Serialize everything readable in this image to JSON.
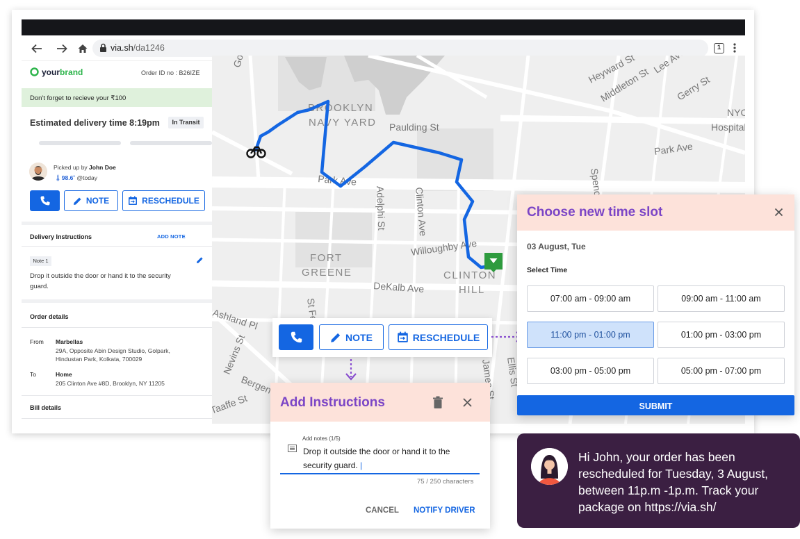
{
  "browser": {
    "url_domain": "via.sh",
    "url_path": "/da1246",
    "tab_count": "1",
    "icons": [
      "back-arrow-icon",
      "forward-arrow-icon",
      "home-icon",
      "lock-icon",
      "tabs-icon",
      "kebab-menu-icon"
    ]
  },
  "map": {
    "labels": [
      "Gold St",
      "BROOKLYN",
      "NAVY YARD",
      "Paulding St",
      "Park Ave",
      "Adelphi St",
      "Clinton Ave",
      "Willoughby Ave",
      "FORT",
      "GREENE",
      "DeKalb Ave",
      "CLINTON",
      "HILL",
      "Heyward St",
      "Middleton St",
      "Lee Ave",
      "Gerry St",
      "NYC",
      "Hospital",
      "Park Ave",
      "Spencer St",
      "St Felix",
      "Nevins St",
      "Bergen St",
      "Ashland Pl",
      "James St",
      "Ellis St",
      "Taaffe St"
    ],
    "route_color": "#1466e2",
    "destination_color": "#2e9b3e"
  },
  "panel": {
    "brand_1": "your",
    "brand_2": "brand",
    "order_id": "Order ID no : B26IZE",
    "notice": "Don't forget to recieve your ₹100",
    "eta": "Estimated delivery time 8:19pm",
    "status": "In Transit",
    "picked_up_prefix": "Picked up by",
    "driver_name": "John Doe",
    "temperature": "98.6˚",
    "temperature_suffix": "@today",
    "btn_note": "NOTE",
    "btn_reschedule": "RESCHEDULE",
    "delivery_instructions": "Delivery Instructions",
    "add_note": "ADD NOTE",
    "note_tag": "Note 1",
    "note_text": "Drop it outside the door or hand it to the security guard.",
    "order_details": "Order details",
    "from_label": "From",
    "from_name": "Marbellas",
    "from_addr_1": "29A, Opposite Abin Design Studio, Golpark,",
    "from_addr_2": "Hindustan Park, Kolkata, 700029",
    "to_label": "To",
    "to_name": "Home",
    "to_addr": "205 Clinton Ave #8D, Brooklyn, NY 11205",
    "bill_details": "Bill details"
  },
  "floating_buttons": {
    "note": "NOTE",
    "reschedule": "RESCHEDULE"
  },
  "instructions": {
    "title": "Add Instructions",
    "field_label": "Add notes (1/5)",
    "field_value": "Drop it outside the door or hand it to the security guard.",
    "char_count": "75 / 250 characters",
    "cancel": "CANCEL",
    "notify": "NOTIFY DRIVER"
  },
  "time_slot": {
    "title": "Choose new time slot",
    "date": "03 August, Tue",
    "select_label": "Select Time",
    "slots": [
      "07:00 am - 09:00 am",
      "09:00 am - 11:00 am",
      "11:00 pm - 01:00 pm",
      "01:00 pm - 03:00 pm",
      "03:00 pm - 05:00 pm",
      "05:00 pm - 07:00 pm"
    ],
    "selected_slot": "11:00 pm - 01:00 pm",
    "submit": "SUBMIT"
  },
  "sms": {
    "message": "Hi John, your order has been rescheduled for Tuesday,  3 August, between 11p.m -1p.m. Track your package on https://via.sh/"
  },
  "colors": {
    "primary_blue": "#1466e2",
    "purple": "#7b45c6",
    "header_peach": "#fde2da",
    "notice_green": "#dff1dc",
    "sms_bg": "#3b1f42",
    "connector_purple": "#8a4fd0"
  }
}
